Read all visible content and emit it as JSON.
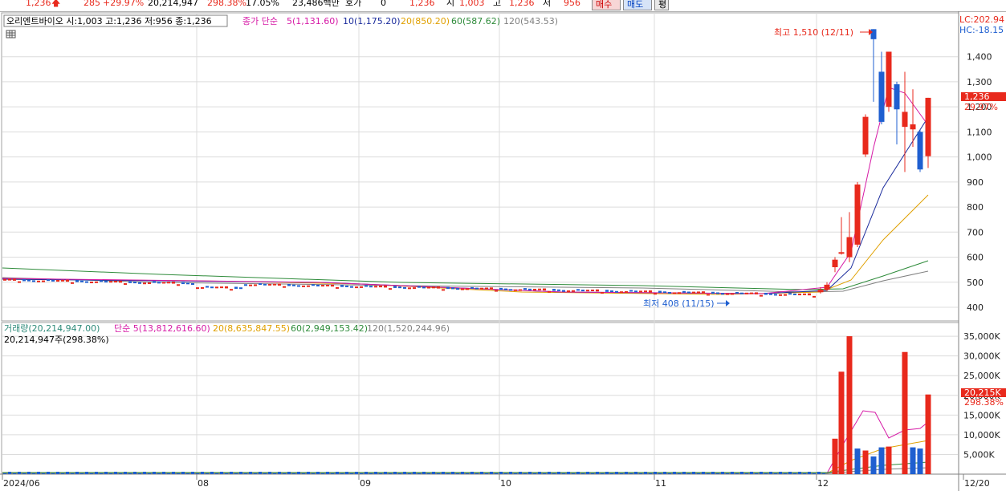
{
  "topbar": {
    "price": "1,236",
    "change": "285",
    "change_pct": "+29.97%",
    "volume": "20,214,947",
    "volume_ratio": "298.38%",
    "turnover": "17.05%",
    "amount": "23,486백만",
    "hoga_label": "호가",
    "hoga_value": "0",
    "hoga_price": "1,236",
    "open_label": "시",
    "open": "1,003",
    "high_label": "고",
    "high": "1,236",
    "low_label": "저",
    "low": "956",
    "buy_label": "매수",
    "sell_label": "매도",
    "extra_label": "평"
  },
  "price_panel": {
    "info": "오리엔트바이오 시:1,003 고:1,236 저:956 종:1,236",
    "ma_label_prefix": "종가 단순",
    "ma5": "5(1,131.60)",
    "ma10": "10(1,175.20)",
    "ma20": "20(850.20)",
    "ma60": "60(587.62)",
    "ma120": "120(543.53)",
    "lc": "LC:202.94",
    "hc": "HC:-18.15",
    "cur_price_tag": "1,236",
    "cur_pct_tag": "29.97%",
    "high_annot": "최고 1,510 (12/11)",
    "low_annot": "최저 408 (11/15)"
  },
  "volume_panel": {
    "vol_label": "거래량(20,214,947.00)",
    "ma5": "단순 5(13,812,616.60)",
    "ma20": "20(8,635,847.55)",
    "ma60": "60(2,949,153.42)",
    "ma120": "120(1,520,244.96)",
    "cur_line": "20,214,947주(298.38%)",
    "cur_vol_tag": "20,215K",
    "cur_vol_pct_tag": "298.38%"
  },
  "colors": {
    "up": "#e8291c",
    "down": "#1f5fd0",
    "ma5": "#d61aa6",
    "ma10": "#1a2b9c",
    "ma20": "#e0a000",
    "ma60": "#2e8b3a",
    "ma120": "#808080",
    "grid": "#dcdcdc"
  },
  "chart_data": [
    {
      "type": "candlestick",
      "title": "오리엔트바이오",
      "x_ticks": [
        "2024/06",
        "08",
        "09",
        "10",
        "11",
        "12",
        "12/20"
      ],
      "ylim": [
        370,
        1560
      ],
      "y_ticks": [
        400,
        500,
        600,
        700,
        800,
        900,
        1000,
        1100,
        1200,
        1300,
        1400
      ],
      "grid": true,
      "candles": [
        {
          "date": "12/02",
          "o": 460,
          "h": 480,
          "l": 455,
          "c": 470
        },
        {
          "date": "12/03",
          "o": 470,
          "h": 500,
          "l": 465,
          "c": 490
        },
        {
          "date": "12/04",
          "o": 560,
          "h": 600,
          "l": 540,
          "c": 590
        },
        {
          "date": "12/05",
          "o": 620,
          "h": 760,
          "l": 610,
          "c": 620
        },
        {
          "date": "12/06",
          "o": 600,
          "h": 780,
          "l": 580,
          "c": 680
        },
        {
          "date": "12/09",
          "o": 650,
          "h": 900,
          "l": 640,
          "c": 890
        },
        {
          "date": "12/10",
          "o": 1010,
          "h": 1170,
          "l": 1000,
          "c": 1160
        },
        {
          "date": "12/11",
          "o": 1510,
          "h": 1510,
          "l": 1220,
          "c": 1470
        },
        {
          "date": "12/12",
          "o": 1340,
          "h": 1420,
          "l": 1130,
          "c": 1140
        },
        {
          "date": "12/13",
          "o": 1200,
          "h": 1420,
          "l": 1180,
          "c": 1420
        },
        {
          "date": "12/16",
          "o": 1290,
          "h": 1300,
          "l": 1050,
          "c": 1190
        },
        {
          "date": "12/17",
          "o": 1120,
          "h": 1340,
          "l": 940,
          "c": 1180
        },
        {
          "date": "12/18",
          "o": 1110,
          "h": 1270,
          "l": 1040,
          "c": 1130
        },
        {
          "date": "12/19",
          "o": 1100,
          "h": 1110,
          "l": 940,
          "c": 950
        },
        {
          "date": "12/20",
          "o": 1003,
          "h": 1236,
          "l": 956,
          "c": 1236
        }
      ],
      "period_high": {
        "value": 1510,
        "date": "12/11"
      },
      "period_low": {
        "value": 408,
        "date": "11/15"
      }
    },
    {
      "type": "bar",
      "title": "거래량",
      "ylim": [
        0,
        36000
      ],
      "y_ticks": [
        5000,
        10000,
        15000,
        20000,
        25000,
        30000,
        35000
      ],
      "unit": "K",
      "grid": true,
      "bars": [
        {
          "date": "12/04",
          "value": 9000,
          "dir": "up"
        },
        {
          "date": "12/05",
          "value": 26000,
          "dir": "up"
        },
        {
          "date": "12/06",
          "value": 35000,
          "dir": "up"
        },
        {
          "date": "12/09",
          "value": 6500,
          "dir": "down"
        },
        {
          "date": "12/10",
          "value": 6000,
          "dir": "up"
        },
        {
          "date": "12/11",
          "value": 4500,
          "dir": "down"
        },
        {
          "date": "12/12",
          "value": 6800,
          "dir": "down"
        },
        {
          "date": "12/13",
          "value": 7000,
          "dir": "up"
        },
        {
          "date": "12/16",
          "value": 31000,
          "dir": "up"
        },
        {
          "date": "12/17",
          "value": 6800,
          "dir": "down"
        },
        {
          "date": "12/18",
          "value": 6500,
          "dir": "down"
        },
        {
          "date": "12/20",
          "value": 20215,
          "dir": "up"
        }
      ]
    }
  ]
}
